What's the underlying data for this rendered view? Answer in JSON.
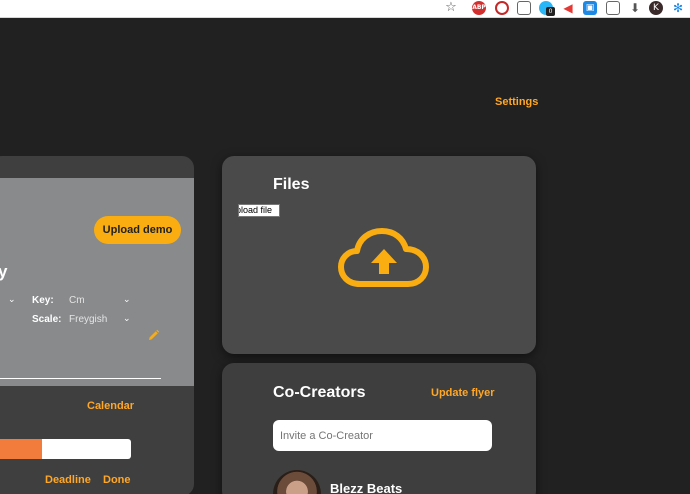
{
  "browser": {
    "star_icon": "☆",
    "abp_label": "ABP",
    "badge_count": "0",
    "extensions": [
      "abp-icon",
      "record-icon",
      "screenshot-icon",
      "sync-icon",
      "megaphone-icon",
      "dictionary-icon",
      "window-icon",
      "download-icon",
      "profile-icon",
      "snowflake-icon"
    ]
  },
  "header": {
    "settings_label": "Settings"
  },
  "project": {
    "upload_demo_label": "Upload demo",
    "title_partial": "y",
    "key_label": "Key:",
    "key_value": "Cm",
    "scale_label": "Scale:",
    "scale_value": "Freygish",
    "calendar_label": "Calendar",
    "progress_fraction": 0.37,
    "deadline_label": "Deadline",
    "done_label": "Done"
  },
  "files": {
    "title": "Files",
    "file_input_label": "pload file"
  },
  "cocreators": {
    "title": "Co-Creators",
    "update_flyer_label": "Update flyer",
    "invite_placeholder": "Invite a Co-Creator",
    "members": [
      {
        "name": "Blezz Beats"
      }
    ]
  },
  "colors": {
    "background": "#212121",
    "accent": "#ffa726",
    "button": "#f9ad11",
    "progress": "#f27c3b",
    "card": "#4a4a4a"
  }
}
